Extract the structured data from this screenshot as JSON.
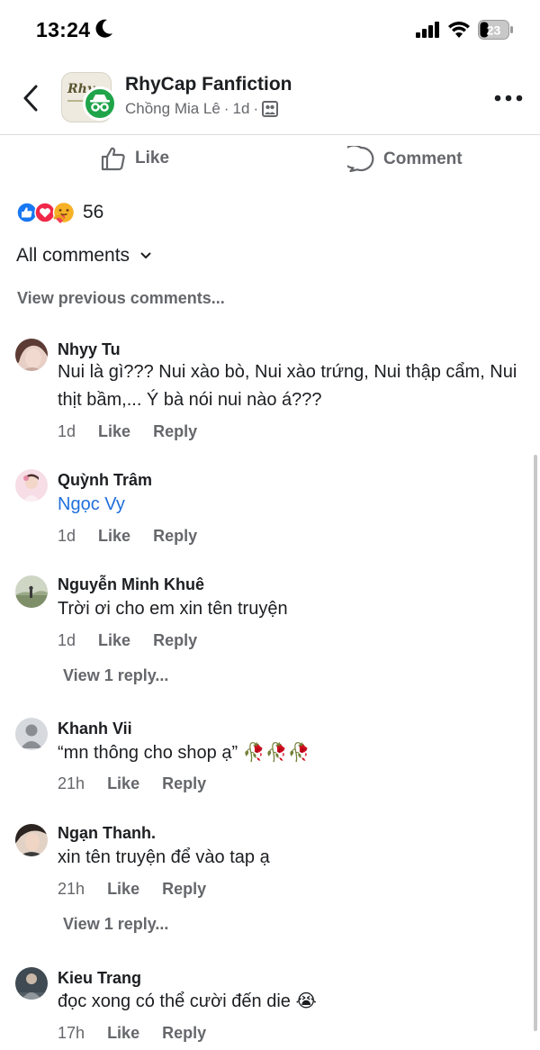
{
  "status_bar": {
    "time": "13:24",
    "battery": "23"
  },
  "header": {
    "page_name": "RhyCap Fanfiction",
    "author": "Chồng Mia Lê",
    "age": "1d",
    "separator": "·",
    "avatar_text": "Rhy"
  },
  "actions": {
    "like_label": "Like",
    "comment_label": "Comment"
  },
  "reactions": {
    "count": "56"
  },
  "sort_label": "All comments",
  "view_previous": "View previous comments...",
  "comments": [
    {
      "name": "Nhyy Tu",
      "text": "Nui là gì??? Nui xào bò, Nui xào trứng, Nui thập cẩm, Nui thịt bầm,... Ý bà nói nui nào á???",
      "time": "1d",
      "like": "Like",
      "reply": "Reply"
    },
    {
      "name": "Quỳnh Trâm",
      "text": "Ngọc Vy",
      "time": "1d",
      "like": "Like",
      "reply": "Reply"
    },
    {
      "name": "Nguyễn Minh Khuê",
      "text": "Trời ơi cho em xin tên truyện",
      "time": "1d",
      "like": "Like",
      "reply": "Reply",
      "view_replies": "View 1 reply..."
    },
    {
      "name": "Khanh Vii",
      "text": "“mn thông cho shop ạ” 🥀🥀🥀",
      "time": "21h",
      "like": "Like",
      "reply": "Reply"
    },
    {
      "name": "Ngạn Thanh.",
      "text": "xin tên truyện để vào tap ạ",
      "time": "21h",
      "like": "Like",
      "reply": "Reply",
      "view_replies": "View 1 reply..."
    },
    {
      "name": "Kieu Trang",
      "text": "đọc xong có thể cười đến die 😭",
      "time": "17h",
      "like": "Like",
      "reply": "Reply"
    }
  ],
  "colors": {
    "mention": "#216fdb",
    "secondary_text": "#65676b",
    "badge_green": "#1fa44a"
  }
}
